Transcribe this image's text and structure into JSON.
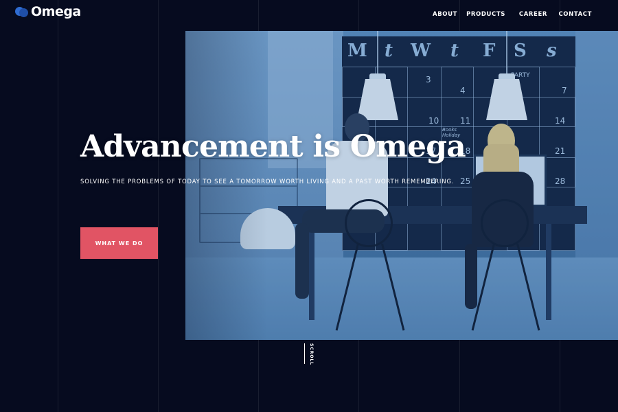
{
  "brand": {
    "name": "Omega"
  },
  "nav": {
    "items": [
      "ABOUT",
      "PRODUCTS",
      "CAREER",
      "CONTACT"
    ]
  },
  "hero": {
    "headline": "Advancement is Omega",
    "subtitle": "SOLVING THE PROBLEMS OF TODAY TO SEE A TOMORROW WORTH LIVING AND A PAST WORTH REMEMBERING.",
    "cta_label": "WHAT WE DO",
    "cta_color": "#e15464"
  },
  "scroll": {
    "label": "SCROLL"
  },
  "calendar": {
    "days": [
      "M",
      "t",
      "W",
      "t",
      "F",
      "S",
      "s"
    ],
    "numbers": [
      "3",
      "4",
      "7",
      "10",
      "11",
      "14",
      "17",
      "18",
      "21",
      "24",
      "25",
      "28"
    ],
    "notes": [
      "PARTY",
      "Books Holiday"
    ]
  },
  "colors": {
    "background": "#060b1f",
    "accent": "#e15464",
    "logo_blue": "#2f6cd1"
  }
}
